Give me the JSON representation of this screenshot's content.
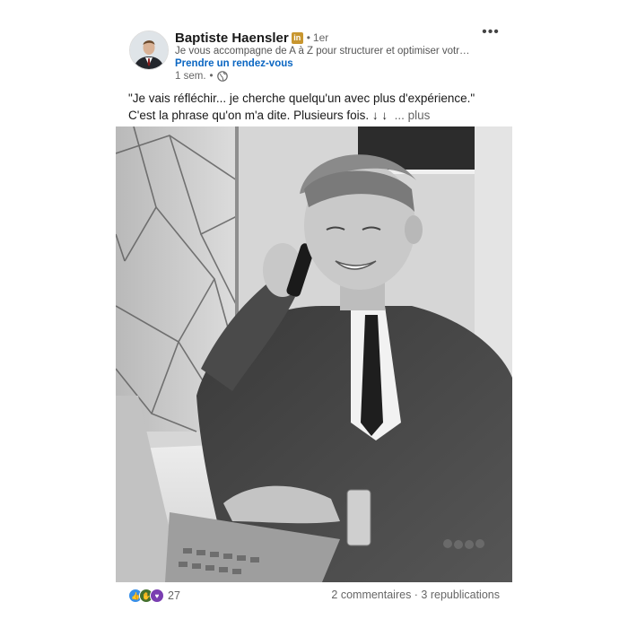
{
  "post": {
    "author": {
      "name": "Baptiste Haensler",
      "badge_icon": "premium-in-icon",
      "degree": "1er",
      "headline": "Je vous accompagne de A à Z pour structurer et optimiser votre...",
      "cta_label": "Prendre un rendez-vous",
      "time": "1 sem.",
      "visibility_icon": "globe-icon"
    },
    "text": {
      "line1": "\"Je vais réfléchir... je cherche quelqu'un avec plus d'expérience.\"",
      "line2": "C'est la phrase qu'on m'a dite. Plusieurs fois. ↓ ↓",
      "see_more": "... plus"
    },
    "social": {
      "reaction_icons": [
        "like-icon",
        "celebrate-icon",
        "support-icon"
      ],
      "reaction_count": "27",
      "comments_reposts": "2 commentaires · 3 republications"
    }
  },
  "colors": {
    "accent_link": "#0a66c2",
    "premium_badge": "#c8962f",
    "secondary_text": "#666666"
  }
}
